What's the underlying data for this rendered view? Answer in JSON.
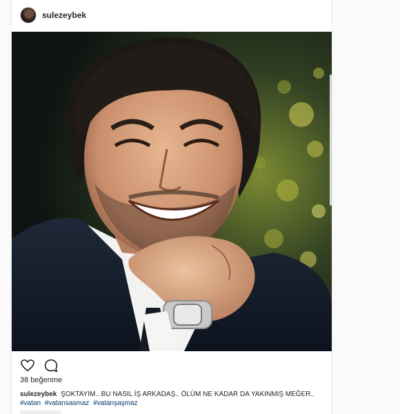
{
  "post": {
    "username": "sulezeybek",
    "photo_description_icon": "portrait-photo",
    "likes_text": "38 beğenme",
    "caption_user": "sulezeybek",
    "caption_text": "ŞOKTAYIM.. BU NASIL İŞ ARKADAŞ.. ÖLÜM NE KADAR DA YAKINMIŞ MEĞER..",
    "hashtags": [
      "#vatan",
      "#vatansasmaz",
      "#vatanşaşmaz"
    ]
  },
  "icons": {
    "like": "heart-icon",
    "comment": "comment-icon"
  },
  "colors": {
    "text": "#262626",
    "hashtag": "#003569",
    "border": "#e6e6e6"
  }
}
